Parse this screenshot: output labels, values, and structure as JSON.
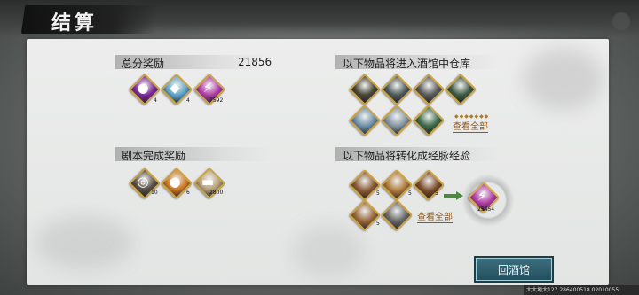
{
  "header": {
    "title": "结算"
  },
  "total_reward": {
    "label": "总分奖励",
    "score": "21856",
    "items": [
      {
        "icon": "purple-orb-icon",
        "qty": "4",
        "color": "#7c2a9a"
      },
      {
        "icon": "blue-crystal-icon",
        "qty": "4",
        "color": "#5fa4c9"
      },
      {
        "icon": "purple-lightning-token-icon",
        "qty": "7592",
        "color": "#b23ea8"
      }
    ]
  },
  "warehouse": {
    "label": "以下物品将进入酒馆中仓库",
    "items": [
      {
        "icon": "gauntlet-icon",
        "color": "#4a4536"
      },
      {
        "icon": "boots-icon",
        "color": "#4e5a58"
      },
      {
        "icon": "dagger-icon",
        "color": "#5a5a5a"
      },
      {
        "icon": "wrist-guard-icon",
        "color": "#3f5a44"
      },
      {
        "icon": "greaves-icon",
        "color": "#6f8fa8"
      },
      {
        "icon": "armored-boots-icon",
        "color": "#8595a2"
      },
      {
        "icon": "jade-bracer-icon",
        "color": "#3d6a4a"
      }
    ],
    "view_all": "查看全部"
  },
  "script_reward": {
    "label": "剧本完成奖励",
    "items": [
      {
        "icon": "pot-icon",
        "qty": "10",
        "color": "#5a5046"
      },
      {
        "icon": "orange-coin-icon",
        "qty": "6",
        "color": "#d07a26"
      },
      {
        "icon": "silver-ingot-icon",
        "qty": "2800",
        "color": "#b9a37a"
      }
    ]
  },
  "convert": {
    "label": "以下物品将转化成经脉经验",
    "items": [
      {
        "icon": "meat-dish-icon",
        "qty": "5",
        "color": "#8a5a34"
      },
      {
        "icon": "bread-icon",
        "qty": "5",
        "color": "#b07a3a"
      },
      {
        "icon": "roast-fish-icon",
        "qty": "5",
        "color": "#7a4a2a"
      },
      {
        "icon": "noodle-bowl-icon",
        "qty": "5",
        "color": "#9a6a3a"
      },
      {
        "icon": "crossed-blades-icon",
        "qty": "",
        "color": "#6a6a6a"
      }
    ],
    "view_all": "查看全部",
    "result": {
      "icon": "purple-lightning-token-icon",
      "qty": "25454",
      "color": "#b23ea8"
    }
  },
  "return_button": "回酒馆",
  "footer": "大大地大127 286400518 02010055"
}
